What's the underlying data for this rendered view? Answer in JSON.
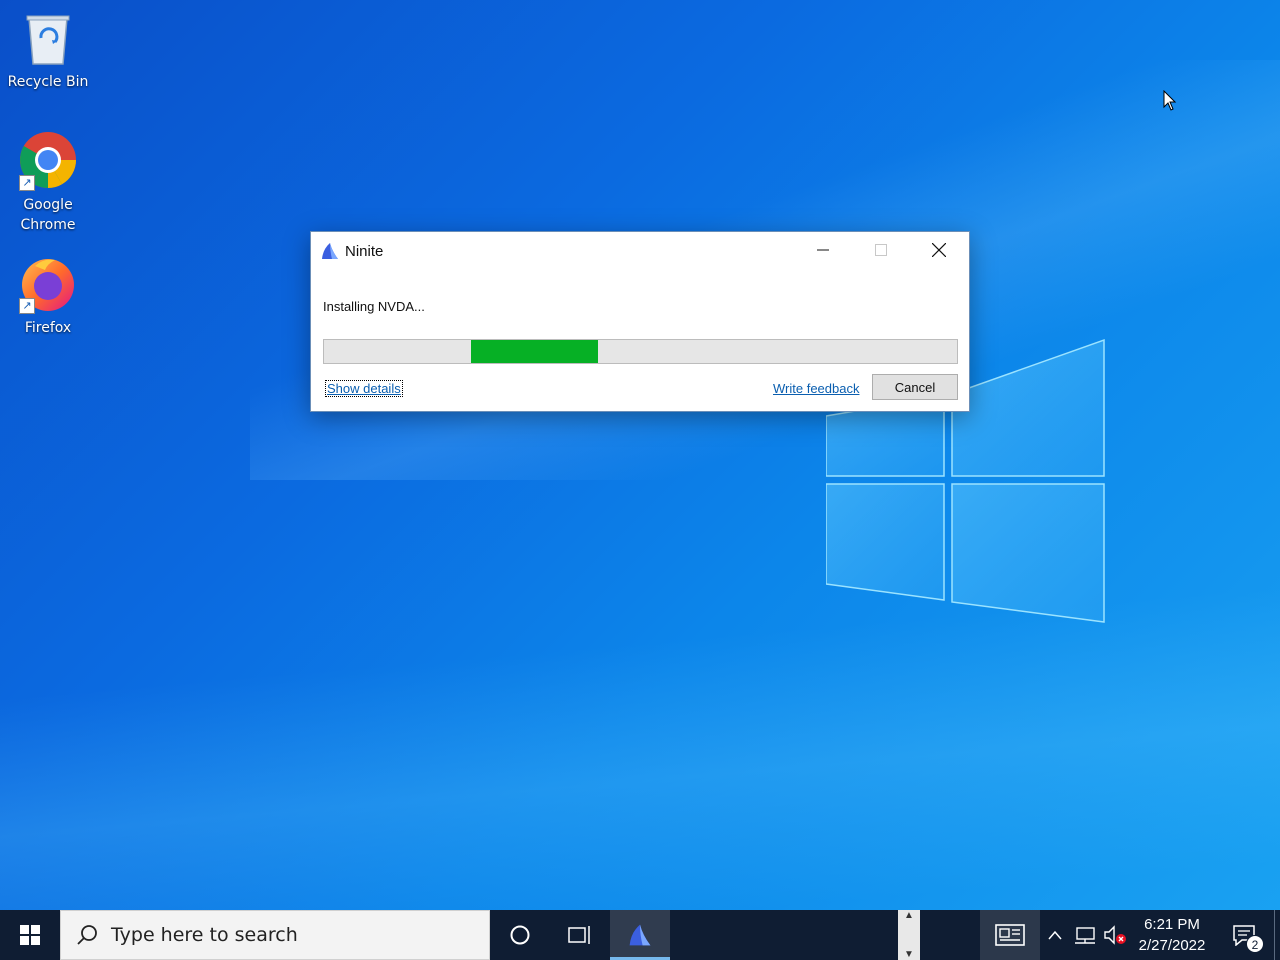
{
  "desktop": {
    "icons": [
      {
        "label": "Recycle Bin",
        "icon": "recycle-bin-icon"
      },
      {
        "label": "Google Chrome",
        "icon": "chrome-icon"
      },
      {
        "label": "Firefox",
        "icon": "firefox-icon"
      }
    ]
  },
  "dialog": {
    "title": "Ninite",
    "status_text": "Installing NVDA...",
    "progress": {
      "start_fraction": 0.233,
      "end_fraction": 0.433,
      "color": "#06b025"
    },
    "show_details_label": "Show details",
    "feedback_label": "Write feedback",
    "cancel_label": "Cancel"
  },
  "taskbar": {
    "search_placeholder": "Type here to search",
    "clock_time": "6:21 PM",
    "clock_date": "2/27/2022",
    "notification_count": "2",
    "accent_color": "#76b9ed"
  }
}
